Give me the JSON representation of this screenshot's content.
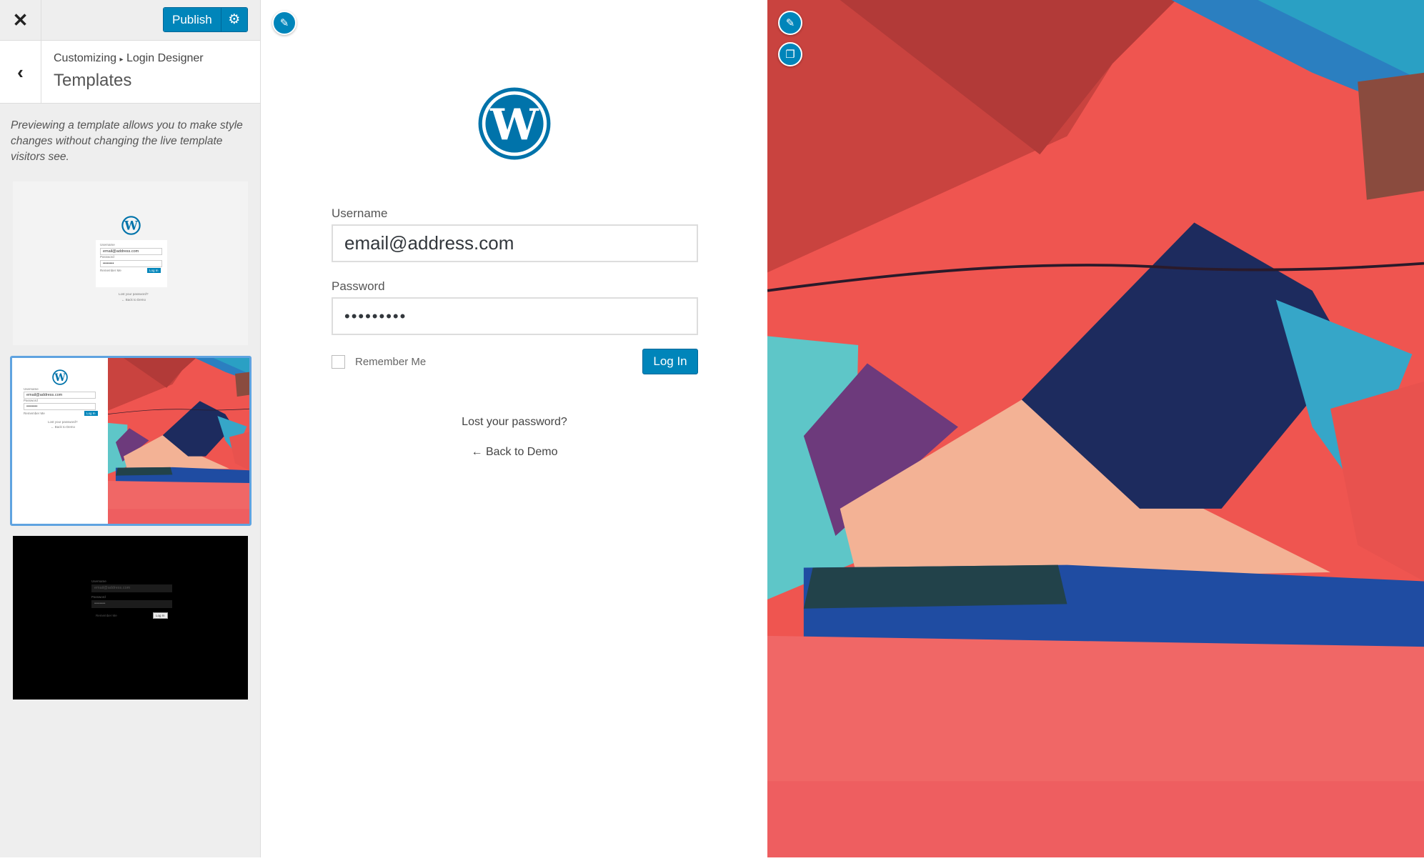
{
  "sidebar": {
    "close_icon": "close-icon",
    "publish_label": "Publish",
    "settings_icon": "gear-icon",
    "back_icon": "chevron-left-icon",
    "breadcrumb": {
      "root": "Customizing",
      "separator": "▸",
      "section": "Login Designer"
    },
    "title": "Templates",
    "description": "Previewing a template allows you to make style changes without changing the live template visitors see.",
    "templates": [
      {
        "name": "default",
        "selected": false,
        "username_label": "Username",
        "username": "email@address.com",
        "password_label": "Password",
        "password": "••••••••",
        "remember": "Remember Me",
        "login": "Log In",
        "lost": "Lost your password?",
        "back": "← Back to Demo"
      },
      {
        "name": "split-image",
        "selected": true,
        "username_label": "Username",
        "username": "email@address.com",
        "password_label": "Password",
        "password": "••••••••",
        "remember": "Remember Me",
        "login": "Log In",
        "lost": "Lost your password?",
        "back": "← Back to Demo"
      },
      {
        "name": "dark",
        "selected": false,
        "username_label": "Username",
        "username": "email@address.com",
        "password_label": "Password",
        "password": "••••••••",
        "remember": "Remember Me",
        "login": "Log In"
      }
    ]
  },
  "preview": {
    "edit_icon": "pencil-icon",
    "logo": "wordpress-logo",
    "username_label": "Username",
    "username_value": "email@address.com",
    "password_label": "Password",
    "password_value": "•••••••••",
    "remember_label": "Remember Me",
    "remember_checked": false,
    "login_label": "Log In",
    "lost_password": "Lost your password?",
    "back_link": "← Back to Demo",
    "background_icons": [
      "pencil-icon",
      "copy-icon"
    ]
  },
  "colors": {
    "accent": "#0085ba",
    "selected_outline": "#5fa3e0",
    "sidebar_bg": "#eeeeee"
  }
}
